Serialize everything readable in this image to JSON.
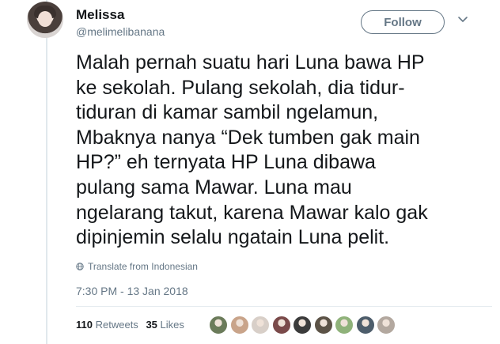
{
  "user": {
    "display_name": "Melissa",
    "handle": "@melimelibanana"
  },
  "follow_button": {
    "label": "Follow"
  },
  "tweet": {
    "lines": [
      "Malah pernah suatu hari Luna bawa HP",
      "ke sekolah. Pulang sekolah, dia tidur-",
      "tiduran di kamar sambil ngelamun,",
      "Mbaknya nanya “Dek tumben gak main",
      "HP?” eh ternyata HP Luna dibawa",
      "pulang sama Mawar. Luna mau",
      "ngelarang takut, karena Mawar kalo gak",
      "dipinjemin selalu ngatain Luna pelit."
    ],
    "translate_label": "Translate from Indonesian",
    "timestamp": "7:30 PM - 13 Jan 2018"
  },
  "stats": {
    "retweets_count": "110",
    "retweets_label": "Retweets",
    "likes_count": "35",
    "likes_label": "Likes"
  },
  "liker_avatars": [
    {
      "icon": "liker-avatar",
      "color": "#6b7b5a"
    },
    {
      "icon": "liker-avatar",
      "color": "#c9a48a"
    },
    {
      "icon": "liker-avatar",
      "color": "#d8cfc8"
    },
    {
      "icon": "liker-avatar",
      "color": "#7a4a4a"
    },
    {
      "icon": "liker-avatar",
      "color": "#3b3b3b"
    },
    {
      "icon": "liker-avatar",
      "color": "#5c5347"
    },
    {
      "icon": "liker-avatar",
      "color": "#8fb27a"
    },
    {
      "icon": "liker-avatar",
      "color": "#4d5d6b"
    },
    {
      "icon": "liker-avatar",
      "color": "#b3a89f"
    }
  ],
  "colors": {
    "text": "#14171a",
    "secondary": "#657786",
    "divider": "#e6ecf0"
  }
}
